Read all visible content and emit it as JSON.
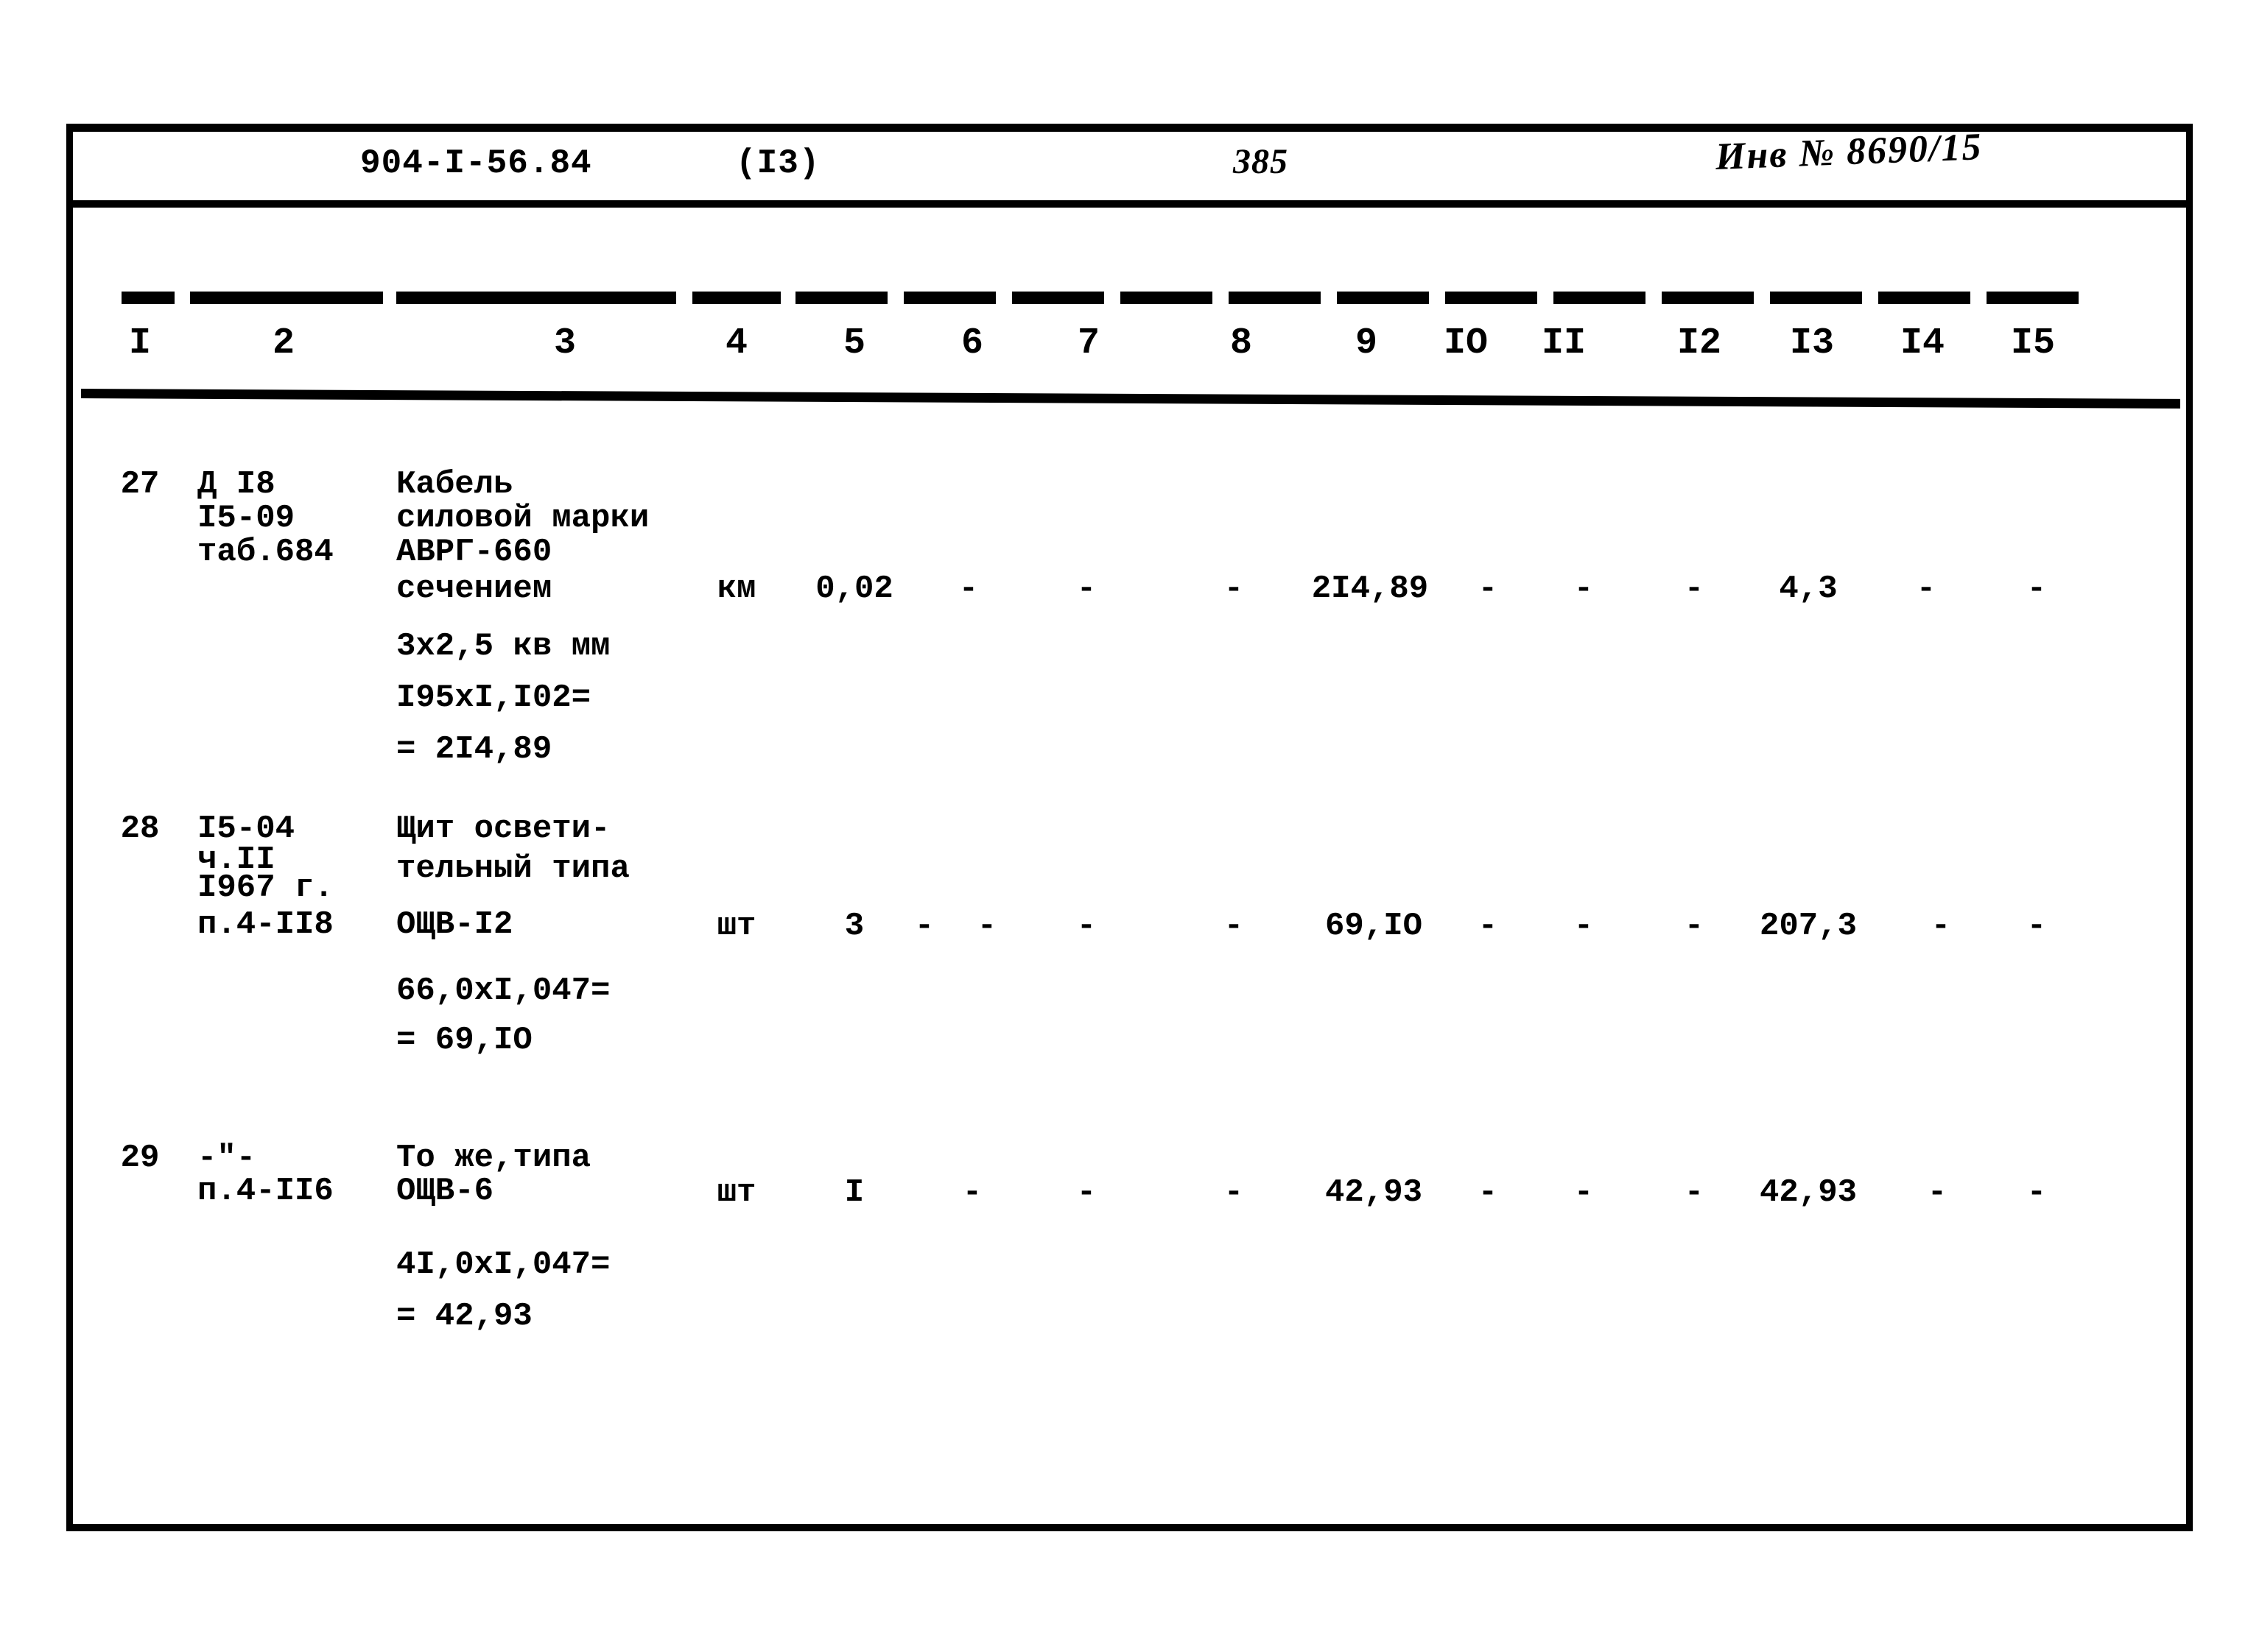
{
  "header": {
    "document_code": "904-I-56.84",
    "sheet_code": "(I3)",
    "page_number": "385",
    "inventory_label": "Инв № 8690/15"
  },
  "table": {
    "column_numbers": [
      "I",
      "2",
      "3",
      "4",
      "5",
      "6",
      "7",
      "8",
      "9",
      "IO",
      "II",
      "I2",
      "I3",
      "I4",
      "I5"
    ],
    "rows": [
      {
        "col1_no": "27",
        "col2_ref_lines": [
          "Д I8",
          "I5-09",
          "таб.684"
        ],
        "col3_name_lines": [
          "Кабель",
          "силовой марки",
          "АВРГ-660",
          "сечением",
          "3х2,5 кв мм"
        ],
        "col3_calc_lines": [
          "I95xI,I02=",
          "= 2I4,89"
        ],
        "col4_unit": "км",
        "col5_qty": "0,02",
        "col6": "-",
        "col7": "-",
        "col8": "-",
        "col9": "2I4,89",
        "col10": "-",
        "col11": "-",
        "col12": "-",
        "col13": "4,3",
        "col14": "-",
        "col15": "-"
      },
      {
        "col1_no": "28",
        "col2_ref_lines": [
          "I5-04",
          "ч.II",
          "I967 г.",
          "п.4-II8"
        ],
        "col3_name_lines": [
          "Щит освети-",
          "тельный типа",
          "ОЩВ-I2"
        ],
        "col3_calc_lines": [
          "66,0xI,047=",
          "= 69,IO"
        ],
        "col4_unit": "шт",
        "col5_qty": "3",
        "col6": "-",
        "col6b": "-",
        "col7": "-",
        "col8": "-",
        "col9": "69,IO",
        "col10": "-",
        "col11": "-",
        "col12": "-",
        "col13": "207,3",
        "col14": "-",
        "col15": "-"
      },
      {
        "col1_no": "29",
        "col2_ref_lines": [
          "-\"-",
          "п.4-II6"
        ],
        "col3_name_lines": [
          "То же,типа",
          "ОЩВ-6"
        ],
        "col3_calc_lines": [
          "4I,0xI,047=",
          "= 42,93"
        ],
        "col4_unit": "шт",
        "col5_qty": "I",
        "col6": "-",
        "col7": "-",
        "col8": "-",
        "col9": "42,93",
        "col10": "-",
        "col11": "-",
        "col12": "-",
        "col13": "42,93",
        "col14": "-",
        "col15": "-"
      }
    ]
  }
}
